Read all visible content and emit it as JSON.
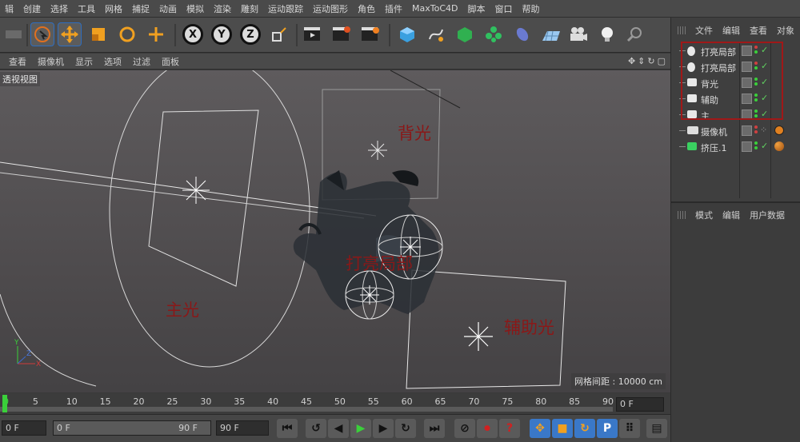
{
  "menu": [
    "辑",
    "创建",
    "选择",
    "工具",
    "网格",
    "捕捉",
    "动画",
    "模拟",
    "渲染",
    "雕刻",
    "运动跟踪",
    "运动图形",
    "角色",
    "插件",
    "MaxToC4D",
    "脚本",
    "窗口",
    "帮助"
  ],
  "axes": {
    "x": "X",
    "y": "Y",
    "z": "Z"
  },
  "viewport_menu": [
    "查看",
    "摄像机",
    "显示",
    "选项",
    "过滤",
    "面板"
  ],
  "viewport_tab": "透视视图",
  "scene_labels": {
    "back": "背光",
    "local": "打亮局部",
    "main": "主光",
    "fill": "辅助光"
  },
  "grid_spacing": "网格间距 : 10000 cm",
  "timeline": {
    "ticks": [
      "0",
      "5",
      "10",
      "15",
      "20",
      "25",
      "30",
      "35",
      "40",
      "45",
      "50",
      "55",
      "60",
      "65",
      "70",
      "75",
      "80",
      "85",
      "90"
    ],
    "current_frame": "0 F"
  },
  "transport": {
    "start": "0 F",
    "range_start": "0 F",
    "range_end": "90 F",
    "end": "90 F"
  },
  "object_manager": {
    "header": [
      "文件",
      "编辑",
      "查看",
      "对象"
    ],
    "objects": [
      {
        "name": "打亮局部",
        "icon": "light-bulb-icon"
      },
      {
        "name": "打亮局部",
        "icon": "light-bulb-icon"
      },
      {
        "name": "背光",
        "icon": "area-light-icon"
      },
      {
        "name": "辅助",
        "icon": "area-light-icon"
      },
      {
        "name": "主",
        "icon": "area-light-icon"
      },
      {
        "name": "摄像机",
        "icon": "camera-icon"
      },
      {
        "name": "挤压.1",
        "icon": "extrude-icon"
      }
    ]
  },
  "attribute_manager": {
    "header": [
      "模式",
      "编辑",
      "用户数据"
    ]
  },
  "colors": {
    "highlight_box": "#a01818",
    "label": "#8a1818",
    "check": "#5fd05f"
  }
}
